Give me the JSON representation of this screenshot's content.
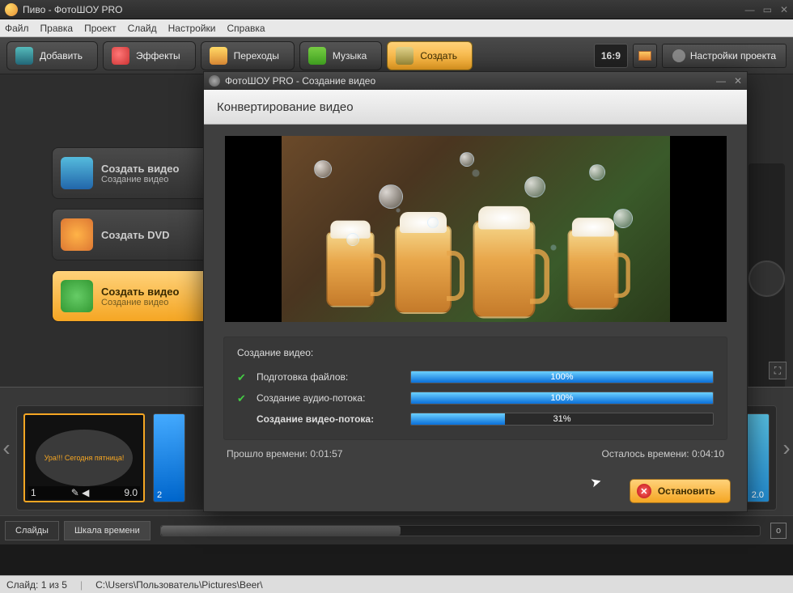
{
  "window": {
    "title": "Пиво - ФотоШОУ PRO"
  },
  "menu": [
    "Файл",
    "Правка",
    "Проект",
    "Слайд",
    "Настройки",
    "Справка"
  ],
  "tabs": {
    "add": "Добавить",
    "effects": "Эффекты",
    "transitions": "Переходы",
    "music": "Музыка",
    "create": "Создать"
  },
  "aspect": "16:9",
  "project_settings": "Настройки проекта",
  "actions": [
    {
      "title": "Создать видео",
      "sub": "Создание видео"
    },
    {
      "title": "Создать DVD",
      "sub": ""
    },
    {
      "title": "Создать видео",
      "sub": "Создание видео"
    }
  ],
  "timeline": {
    "thumb1": {
      "index": "1",
      "duration": "9.0",
      "caption": "Ура!!! Сегодня пятница!"
    },
    "thumb2": {
      "index": "2"
    },
    "thumbR": {
      "duration": "2.0"
    },
    "tabs": {
      "slides": "Слайды",
      "timescale": "Шкала времени"
    },
    "zoom_out": "о"
  },
  "status": {
    "slide": "Слайд: 1 из 5",
    "path": "C:\\Users\\Пользователь\\Pictures\\Beer\\"
  },
  "dialog": {
    "title": "ФотоШОУ PRO - Создание видео",
    "heading": "Конвертирование видео",
    "section_title": "Создание видео:",
    "rows": {
      "prepare": {
        "label": "Подготовка файлов:",
        "pct": "100%",
        "width": 100
      },
      "audio": {
        "label": "Создание аудио-потока:",
        "pct": "100%",
        "width": 100
      },
      "video": {
        "label": "Создание видео-потока:",
        "pct": "31%",
        "width": 31
      }
    },
    "elapsed_label": "Прошло времени:",
    "elapsed": "0:01:57",
    "remaining_label": "Осталось времени:",
    "remaining": "0:04:10",
    "stop": "Остановить"
  }
}
